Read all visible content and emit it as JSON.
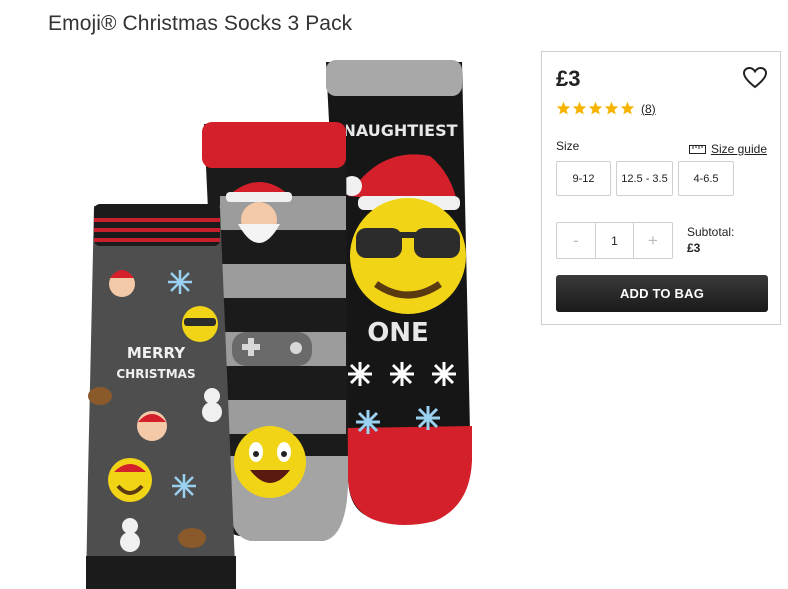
{
  "product": {
    "title": "Emoji® Christmas Socks 3 Pack",
    "image_alt": "Three Christmas socks with emoji designs",
    "sock_texts": {
      "merry": "MERRY",
      "christmas": "CHRISTMAS",
      "naughtiest": "NAUGHTIEST",
      "one": "ONE"
    }
  },
  "purchase": {
    "price": "£3",
    "rating": 5,
    "review_count": "(8)",
    "size_label": "Size",
    "size_guide_label": "Size guide",
    "sizes": [
      "9-12",
      "12.5 - 3.5",
      "4-6.5"
    ],
    "quantity": "1",
    "minus": "-",
    "plus": "+",
    "subtotal_label": "Subtotal:",
    "subtotal_value": "£3",
    "add_to_bag": "ADD TO BAG"
  },
  "colors": {
    "star": "#f5b400",
    "button_dark": "#222222",
    "border": "#cfcfcf"
  },
  "icons": [
    "heart-outline-icon",
    "star-icon",
    "ruler-icon"
  ]
}
